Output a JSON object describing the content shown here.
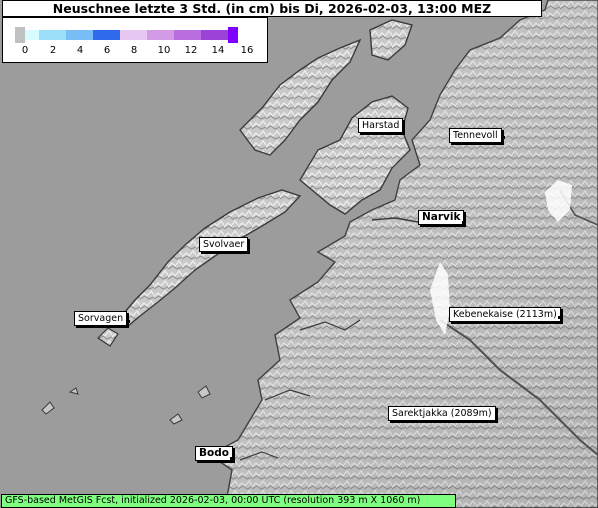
{
  "title": "Neuschnee letzte 3 Std. (in cm) bis Di, 2026-02-03, 13:00 MEZ",
  "legend": {
    "ticks": [
      "0",
      "2",
      "4",
      "6",
      "8",
      "10",
      "12",
      "14",
      "16"
    ],
    "colors": [
      "#c0c0c0",
      "#d8fbff",
      "#9be0f8",
      "#78bdf5",
      "#5896ef",
      "#2f6aec",
      "#e6c8f2",
      "#d39ae6",
      "#b96ee0",
      "#9c42d8",
      "#8000ff"
    ]
  },
  "places": [
    {
      "name": "Harstad",
      "bold": false
    },
    {
      "name": "Tennevoll",
      "bold": false
    },
    {
      "name": "Narvik",
      "bold": true
    },
    {
      "name": "Svolvaer",
      "bold": false
    },
    {
      "name": "Sorvagen",
      "bold": false
    },
    {
      "name": "Kebenekaise (2113m)",
      "bold": false
    },
    {
      "name": "Sarektjakka (2089m)",
      "bold": false
    },
    {
      "name": "Bodo",
      "bold": true
    }
  ],
  "footer": "GFS-based MetGIS Fcst, initialized 2026-02-03, 00:00 UTC  (resolution 393 m X 1060 m)",
  "colors": {
    "sea": "#9c9c9c",
    "land": "#c8c8c8",
    "coast": "#3a3a3a",
    "footer_bg": "#7fff7f"
  }
}
